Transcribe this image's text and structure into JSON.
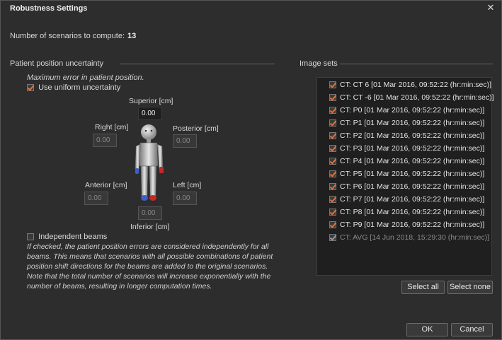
{
  "window": {
    "title": "Robustness Settings",
    "close_glyph": "✕"
  },
  "scenarios": {
    "label": "Number of scenarios to compute:",
    "value": "13"
  },
  "patient": {
    "group_title": "Patient position uncertainty",
    "description": "Maximum error in patient position.",
    "uniform_label": "Use uniform uncertainty",
    "uniform_checked": true,
    "fields": {
      "superior": {
        "label": "Superior [cm]",
        "value": "0.00"
      },
      "right": {
        "label": "Right [cm]",
        "value": "0.00"
      },
      "posterior": {
        "label": "Posterior [cm]",
        "value": "0.00"
      },
      "anterior": {
        "label": "Anterior [cm]",
        "value": "0.00"
      },
      "left": {
        "label": "Left [cm]",
        "value": "0.00"
      },
      "inferior": {
        "label": "Inferior [cm]",
        "value": "0.00"
      }
    },
    "independent_label": "Independent beams",
    "independent_checked": false,
    "independent_help": "If checked, the patient position errors are considered independently for all beams. This means that scenarios with all possible combinations of patient position shift directions for the beams are added to the original scenarios. Note that the total number of scenarios will increase exponentially with the number of beams, resulting in longer computation times."
  },
  "image_sets": {
    "group_title": "Image sets",
    "items": [
      {
        "label": "CT: CT 6 [01 Mar 2016, 09:52:22 (hr:min:sec)]",
        "checked": true,
        "enabled": true
      },
      {
        "label": "CT: CT -6 [01 Mar 2016, 09:52:22 (hr:min:sec)]",
        "checked": true,
        "enabled": true
      },
      {
        "label": "CT: P0 [01 Mar 2016, 09:52:22 (hr:min:sec)]",
        "checked": true,
        "enabled": true
      },
      {
        "label": "CT: P1 [01 Mar 2016, 09:52:22 (hr:min:sec)]",
        "checked": true,
        "enabled": true
      },
      {
        "label": "CT: P2 [01 Mar 2016, 09:52:22 (hr:min:sec)]",
        "checked": true,
        "enabled": true
      },
      {
        "label": "CT: P3 [01 Mar 2016, 09:52:22 (hr:min:sec)]",
        "checked": true,
        "enabled": true
      },
      {
        "label": "CT: P4 [01 Mar 2016, 09:52:22 (hr:min:sec)]",
        "checked": true,
        "enabled": true
      },
      {
        "label": "CT: P5 [01 Mar 2016, 09:52:22 (hr:min:sec)]",
        "checked": true,
        "enabled": true
      },
      {
        "label": "CT: P6 [01 Mar 2016, 09:52:22 (hr:min:sec)]",
        "checked": true,
        "enabled": true
      },
      {
        "label": "CT: P7 [01 Mar 2016, 09:52:22 (hr:min:sec)]",
        "checked": true,
        "enabled": true
      },
      {
        "label": "CT: P8 [01 Mar 2016, 09:52:22 (hr:min:sec)]",
        "checked": true,
        "enabled": true
      },
      {
        "label": "CT: P9 [01 Mar 2016, 09:52:22 (hr:min:sec)]",
        "checked": true,
        "enabled": true
      },
      {
        "label": "CT: AVG [14 Jun 2018, 15:29:30 (hr:min:sec)]",
        "checked": true,
        "enabled": false
      }
    ],
    "select_all": "Select all",
    "select_none": "Select none"
  },
  "footer": {
    "ok": "OK",
    "cancel": "Cancel"
  },
  "colors": {
    "accent": "#e0703a",
    "background": "#2d2d2d",
    "list_bg": "#1f1f1f"
  }
}
